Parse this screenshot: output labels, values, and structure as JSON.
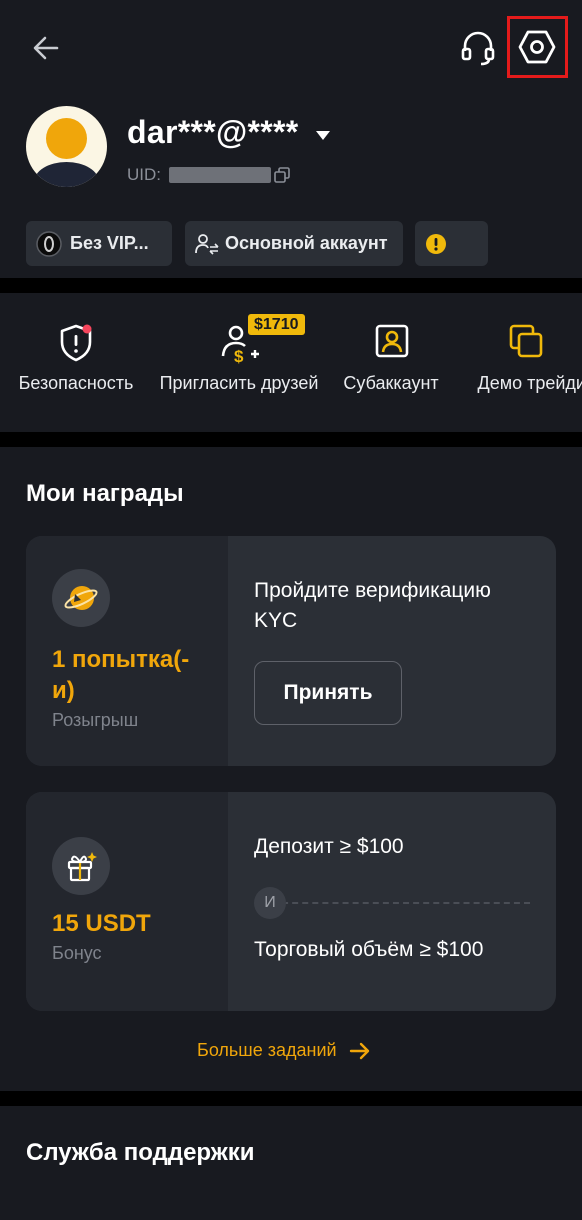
{
  "header": {
    "back_icon": "arrow-left-icon",
    "support_icon": "headset-icon",
    "settings_icon": "settings-hexagon-icon"
  },
  "profile": {
    "email": "dar***@****",
    "uid_label": "UID:",
    "chips": [
      {
        "label": "Без VIP...",
        "icon": "vip-coin-icon"
      },
      {
        "label": "Основной аккаунт",
        "icon": "user-switch-icon"
      },
      {
        "label": "",
        "icon": "warning-icon"
      }
    ]
  },
  "quick_actions": [
    {
      "label": "Безопасность",
      "icon": "shield-alert-icon"
    },
    {
      "label": "Пригласить друзей",
      "icon": "invite-user-icon",
      "badge": "$1710"
    },
    {
      "label": "Субаккаунт",
      "icon": "subaccount-icon"
    },
    {
      "label": "Демо трейдинг",
      "icon": "demo-trading-icon"
    }
  ],
  "rewards": {
    "title": "Мои награды",
    "card1": {
      "value_line1": "1 попытка(-",
      "value_line2": "и)",
      "caption": "Розыгрыш",
      "task_line1": "Пройдите верификацию",
      "task_line2": "KYC",
      "button": "Принять"
    },
    "card2": {
      "value": "15 USDT",
      "caption": "Бонус",
      "task1": "Депозит ≥ $100",
      "and": "И",
      "task2": "Торговый объём ≥ $100"
    },
    "more": "Больше заданий"
  },
  "support": {
    "title": "Служба поддержки"
  },
  "colors": {
    "accent": "#F0B90B",
    "highlight": "#E41B1B",
    "background": "#181A20"
  }
}
